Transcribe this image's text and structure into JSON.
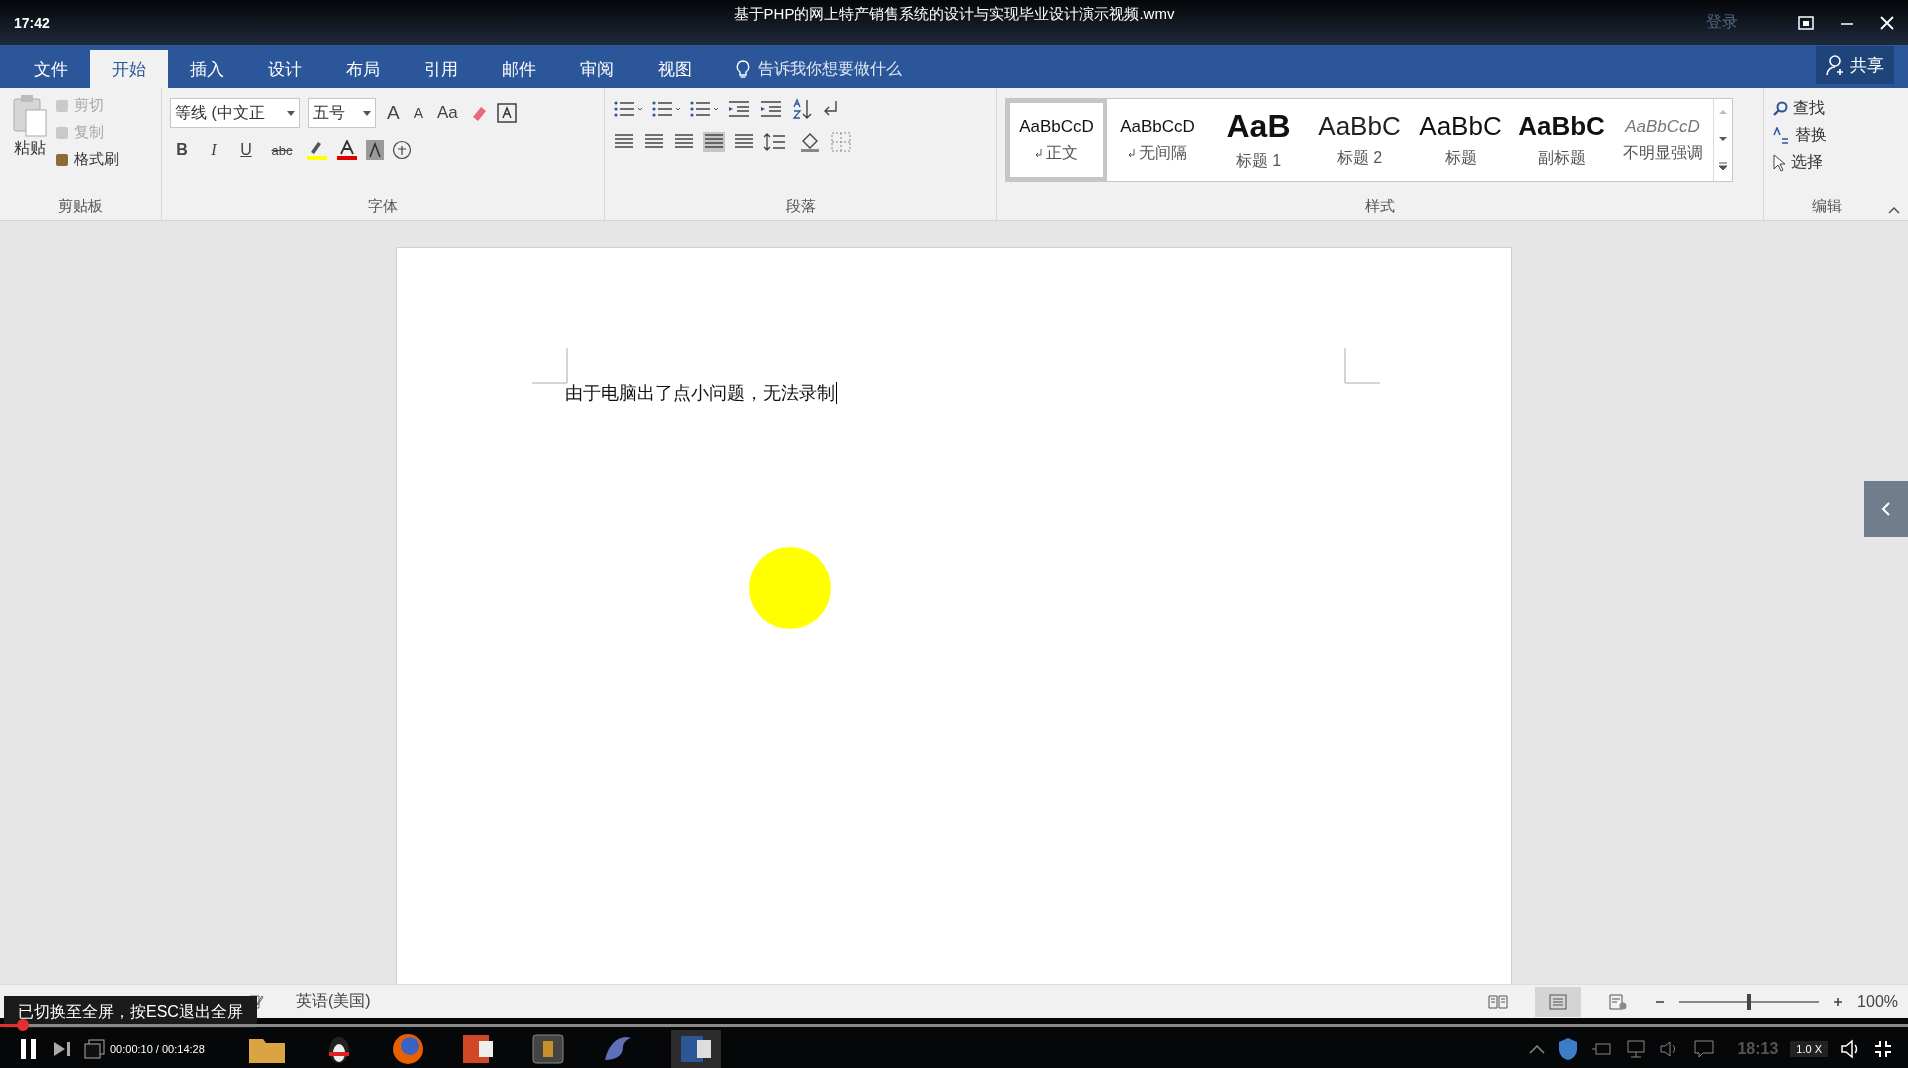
{
  "player_bar": {
    "clock": "17:42",
    "title": "基于PHP的网上特产销售系统的设计与实现毕业设计演示视频.wmv",
    "login": "登录"
  },
  "tabs": [
    {
      "label": "文件",
      "selected": false
    },
    {
      "label": "开始",
      "selected": true
    },
    {
      "label": "插入",
      "selected": false
    },
    {
      "label": "设计",
      "selected": false
    },
    {
      "label": "布局",
      "selected": false
    },
    {
      "label": "引用",
      "selected": false
    },
    {
      "label": "邮件",
      "selected": false
    },
    {
      "label": "审阅",
      "selected": false
    },
    {
      "label": "视图",
      "selected": false
    }
  ],
  "tell_me": {
    "placeholder": "告诉我你想要做什么"
  },
  "share": "共享",
  "clipboard": {
    "label": "剪贴板",
    "paste": "粘贴",
    "items": [
      {
        "label": "剪切",
        "disabled": true
      },
      {
        "label": "复制",
        "disabled": true
      },
      {
        "label": "格式刷",
        "disabled": false
      }
    ]
  },
  "font": {
    "label": "字体",
    "font_name": "等线 (中文正",
    "font_size": "五号",
    "grow": "A",
    "shrink": "A",
    "case": "Aa",
    "format_buttons": [
      "B",
      "I",
      "U",
      "abc"
    ]
  },
  "paragraph": {
    "label": "段落"
  },
  "styles": {
    "label": "样式",
    "items": [
      {
        "preview": "AaBbCcD",
        "name": "正文",
        "kind": "normal",
        "return_mark": true,
        "selected": true
      },
      {
        "preview": "AaBbCcD",
        "name": "无间隔",
        "kind": "normal",
        "return_mark": true,
        "selected": false
      },
      {
        "preview": "AaB",
        "name": "标题 1",
        "kind": "heading1",
        "return_mark": false,
        "selected": false
      },
      {
        "preview": "AaBbC",
        "name": "标题 2",
        "kind": "heading2",
        "return_mark": false,
        "selected": false
      },
      {
        "preview": "AaBbC",
        "name": "标题",
        "kind": "title",
        "return_mark": false,
        "selected": false
      },
      {
        "preview": "AaBbC",
        "name": "副标题",
        "kind": "subtitle",
        "return_mark": false,
        "selected": false
      },
      {
        "preview": "AaBbCcD",
        "name": "不明显强调",
        "kind": "emphasis",
        "return_mark": false,
        "selected": false
      }
    ]
  },
  "editing": {
    "label": "编辑",
    "items": [
      {
        "label": "查找",
        "kind": "find"
      },
      {
        "label": "替换",
        "kind": "replace"
      },
      {
        "label": "选择",
        "kind": "select"
      }
    ]
  },
  "document": {
    "text": "由于电脑出了点小问题，无法录制"
  },
  "status_bar": {
    "language": "英语(美国)",
    "views": [
      {
        "kind": "read",
        "selected": false
      },
      {
        "kind": "print",
        "selected": true
      },
      {
        "kind": "web",
        "selected": false
      }
    ],
    "zoom_slider": {
      "level": 0.5
    },
    "zoom": "100%"
  },
  "toast": "已切换至全屏，按ESC退出全屏",
  "player": {
    "progress": {
      "level": 0.012
    },
    "time": "00:00:10 / 00:14:28",
    "speed": "1.0 X",
    "tray_clock": "18:13"
  }
}
